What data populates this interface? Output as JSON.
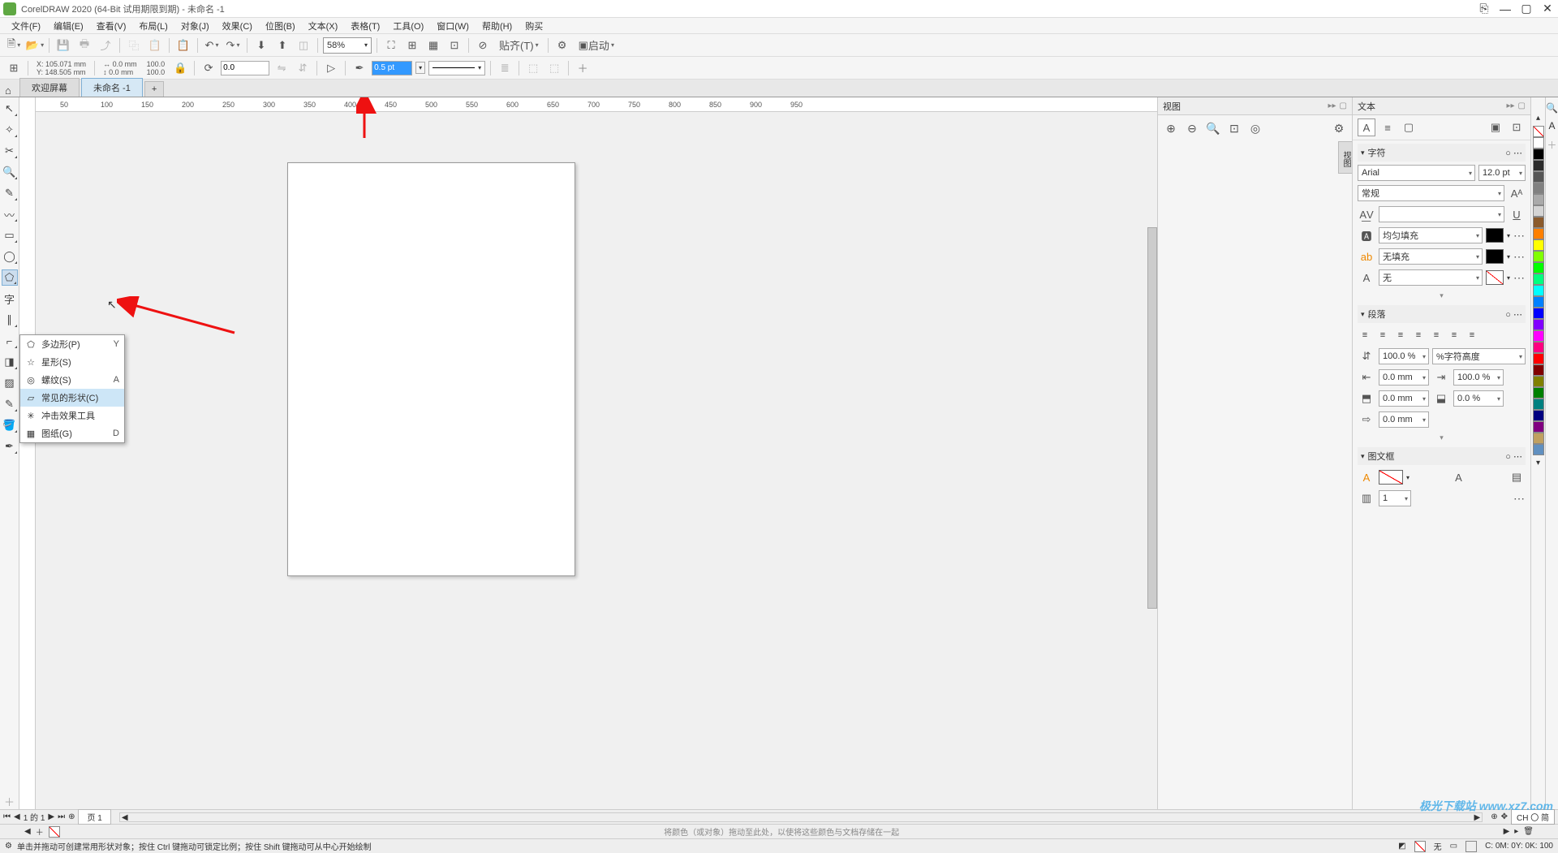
{
  "title": "CorelDRAW 2020 (64-Bit 试用期限到期) - 未命名 -1",
  "menu": [
    "文件(F)",
    "编辑(E)",
    "查看(V)",
    "布局(L)",
    "对象(J)",
    "效果(C)",
    "位图(B)",
    "文本(X)",
    "表格(T)",
    "工具(O)",
    "窗口(W)",
    "帮助(H)",
    "购买"
  ],
  "toolbar1": {
    "zoom": "58%",
    "snap_label": "贴齐(T)",
    "launch_label": "启动"
  },
  "propbar": {
    "x_label": "X:",
    "x": "105.071 mm",
    "y_label": "Y:",
    "y": "148.505 mm",
    "w": "0.0 mm",
    "h": "0.0 mm",
    "sx": "100.0",
    "sy": "100.0",
    "angle": "0.0",
    "outline_width": "0.5 pt"
  },
  "doctabs": {
    "welcome": "欢迎屏幕",
    "doc": "未命名 -1",
    "add": "+"
  },
  "ruler_ticks": [
    "50",
    "100",
    "150",
    "200",
    "250",
    "300",
    "350",
    "400",
    "450",
    "500",
    "550",
    "600",
    "650",
    "700",
    "750",
    "800",
    "850",
    "900",
    "950"
  ],
  "flyout": {
    "items": [
      {
        "ico": "⬠",
        "label": "多边形(P)",
        "short": "Y"
      },
      {
        "ico": "☆",
        "label": "星形(S)",
        "short": ""
      },
      {
        "ico": "◎",
        "label": "螺纹(S)",
        "short": "A"
      },
      {
        "ico": "▱",
        "label": "常见的形状(C)",
        "short": ""
      },
      {
        "ico": "✳",
        "label": "冲击效果工具",
        "short": ""
      },
      {
        "ico": "▦",
        "label": "图纸(G)",
        "short": "D"
      }
    ],
    "hover_index": 3
  },
  "view_panel": {
    "title": "视图",
    "vtab": "视图"
  },
  "text_panel": {
    "title": "文本",
    "section_char": "字符",
    "font": "Arial",
    "font_size": "12.0 pt",
    "font_style": "常规",
    "fill_type": "均匀填充",
    "bg_type": "无填充",
    "outline_type": "无",
    "section_para": "段落",
    "line_spacing": "100.0 %",
    "line_spacing_unit": "%字符高度",
    "indent_left": "0.0 mm",
    "indent_right": "100.0 %",
    "before": "0.0 mm",
    "after": "0.0 %",
    "first_line": "0.0 mm",
    "section_frame": "图文框",
    "columns": "1"
  },
  "lang_indicator": "CH 〇 简",
  "page_bar": {
    "page_info": "1 的 1",
    "page_label": "页 1"
  },
  "status_fill": {
    "hint": "将颜色（或对象）拖动至此处，以使将这些颜色与文档存储在一起"
  },
  "status_hint": {
    "text": "单击并拖动可创建常用形状对象；按住 Ctrl 键拖动可锁定比例；按住 Shift 键拖动可从中心开始绘制",
    "fill_label": "无",
    "coords": "C: 0M: 0Y: 0K: 100"
  },
  "watermark": "极光下载站 www.xz7.com",
  "colors": [
    "#ffffff",
    "#000000",
    "#2b2b2b",
    "#555555",
    "#808080",
    "#aaaaaa",
    "#d4d4d4",
    "#8b5a2b",
    "#ff8000",
    "#ffff00",
    "#80ff00",
    "#00ff00",
    "#00ff80",
    "#00ffff",
    "#0080ff",
    "#0000ff",
    "#8000ff",
    "#ff00ff",
    "#ff0080",
    "#ff0000",
    "#800000",
    "#808000",
    "#008000",
    "#008080",
    "#000080",
    "#800080",
    "#c0a060",
    "#6090c0"
  ]
}
